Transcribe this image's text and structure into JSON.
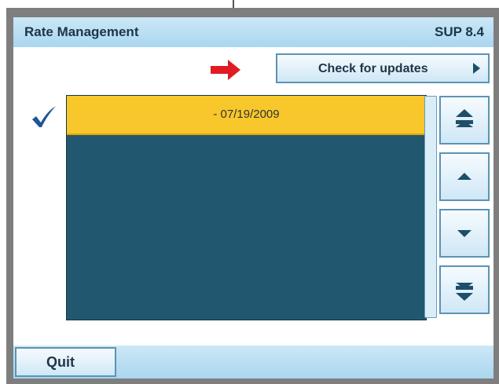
{
  "header": {
    "title": "Rate Management",
    "version": "SUP 8.4"
  },
  "toolbar": {
    "check_updates_label": "Check for updates",
    "arrow_icon": "right-arrow-icon",
    "arrow_color": "#e11b22"
  },
  "rate_list": {
    "items": [
      {
        "label": "- 07/19/2009",
        "selected": true
      }
    ],
    "selected_color": "#f7c72b",
    "background_color": "#21586f",
    "check_icon": "checkmark-icon"
  },
  "scroll_controls": {
    "buttons": [
      {
        "icon": "page-up-icon"
      },
      {
        "icon": "line-up-icon"
      },
      {
        "icon": "line-down-icon"
      },
      {
        "icon": "page-down-icon"
      }
    ]
  },
  "footer": {
    "quit_label": "Quit"
  },
  "colors": {
    "title_bar": "#a9d6ef",
    "accent": "#5b93b4",
    "frame": "#7e7e7e"
  }
}
